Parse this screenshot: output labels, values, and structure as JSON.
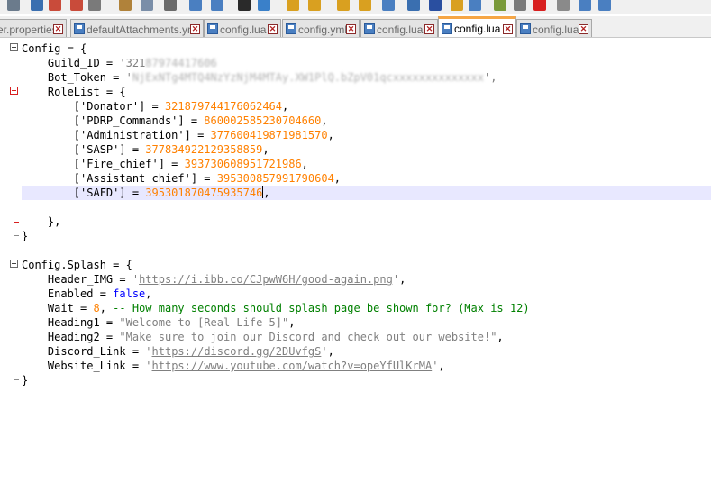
{
  "toolbar": {
    "icons": [
      "save-all-icon",
      "close-icon",
      "close-all-icon",
      "print-icon",
      "cut-icon",
      "copy-icon",
      "paste-icon",
      "undo-icon",
      "redo-icon",
      "find-icon",
      "replace-icon",
      "zoom-in-icon",
      "zoom-out-icon",
      "sync-v-icon",
      "sync-h-icon",
      "wrap-icon",
      "all-chars-icon",
      "indent-guide-icon",
      "doc-map-icon",
      "function-list-icon",
      "folder-workspace-icon",
      "monitor-icon",
      "record-macro-icon",
      "stop-macro-icon",
      "play-macro-icon",
      "run-macro-icon",
      "save-macro-icon"
    ]
  },
  "tabs": [
    {
      "label": "er.properties",
      "active": false
    },
    {
      "label": "defaultAttachments.yml",
      "active": false
    },
    {
      "label": "config.lua",
      "active": false
    },
    {
      "label": "config.yml",
      "active": false
    },
    {
      "label": "config.lua",
      "active": false
    },
    {
      "label": "config.lua",
      "active": true
    },
    {
      "label": "config.lua",
      "active": false
    }
  ],
  "tab_close_glyph": "✕",
  "editor": {
    "lines": [
      {
        "indent": "",
        "tokens": [
          {
            "t": "Config = {",
            "c": ""
          }
        ]
      },
      {
        "indent": "    ",
        "tokens": [
          {
            "t": "Guild_ID = ",
            "c": ""
          },
          {
            "t": "'321",
            "c": "str"
          },
          {
            "t": "87974417606",
            "c": "blur"
          }
        ]
      },
      {
        "indent": "    ",
        "tokens": [
          {
            "t": "Bot_Token = ",
            "c": ""
          },
          {
            "t": "'",
            "c": "str"
          },
          {
            "t": "NjExNTg4MTQ4NzYzNjM4MTAy.XW1PlQ.bZpV01qcxxxxxxxxxxxxxx",
            "c": "blur"
          },
          {
            "t": "',",
            "c": "str"
          }
        ]
      },
      {
        "indent": "    ",
        "tokens": [
          {
            "t": "RoleList = {",
            "c": ""
          }
        ]
      },
      {
        "indent": "        ",
        "tokens": [
          {
            "t": "['Donator'] = ",
            "c": ""
          },
          {
            "t": "321879744176062464",
            "c": "num"
          },
          {
            "t": ",",
            "c": ""
          }
        ]
      },
      {
        "indent": "        ",
        "tokens": [
          {
            "t": "['PDRP_Commands'] = ",
            "c": ""
          },
          {
            "t": "860002585230704660",
            "c": "num"
          },
          {
            "t": ",",
            "c": ""
          }
        ]
      },
      {
        "indent": "        ",
        "tokens": [
          {
            "t": "['Administration'] = ",
            "c": ""
          },
          {
            "t": "377600419871981570",
            "c": "num"
          },
          {
            "t": ",",
            "c": ""
          }
        ]
      },
      {
        "indent": "        ",
        "tokens": [
          {
            "t": "['SASP'] = ",
            "c": ""
          },
          {
            "t": "377834922129358859",
            "c": "num"
          },
          {
            "t": ",",
            "c": ""
          }
        ]
      },
      {
        "indent": "        ",
        "tokens": [
          {
            "t": "['Fire_chief'] = ",
            "c": ""
          },
          {
            "t": "393730608951721986",
            "c": "num"
          },
          {
            "t": ",",
            "c": ""
          }
        ]
      },
      {
        "indent": "        ",
        "tokens": [
          {
            "t": "['Assistant chief'] = ",
            "c": ""
          },
          {
            "t": "395300857991790604",
            "c": "num"
          },
          {
            "t": ",",
            "c": ""
          }
        ]
      },
      {
        "indent": "        ",
        "tokens": [
          {
            "t": "['SAFD'] = ",
            "c": ""
          },
          {
            "t": "395301870475935746",
            "c": "num"
          },
          {
            "t": ",",
            "c": ""
          }
        ],
        "current": true
      },
      {
        "indent": "",
        "tokens": []
      },
      {
        "indent": "    ",
        "tokens": [
          {
            "t": "},",
            "c": ""
          }
        ]
      },
      {
        "indent": "",
        "tokens": [
          {
            "t": "}",
            "c": ""
          }
        ]
      },
      {
        "indent": "",
        "tokens": []
      },
      {
        "indent": "",
        "tokens": [
          {
            "t": "Config.Splash = {",
            "c": ""
          }
        ]
      },
      {
        "indent": "    ",
        "tokens": [
          {
            "t": "Header_IMG = ",
            "c": ""
          },
          {
            "t": "'",
            "c": "str"
          },
          {
            "t": "https://i.ibb.co/CJpwW6H/good-again.png",
            "c": "url"
          },
          {
            "t": "'",
            "c": "str"
          },
          {
            "t": ",",
            "c": ""
          }
        ]
      },
      {
        "indent": "    ",
        "tokens": [
          {
            "t": "Enabled = ",
            "c": ""
          },
          {
            "t": "false",
            "c": "kw"
          },
          {
            "t": ",",
            "c": ""
          }
        ]
      },
      {
        "indent": "    ",
        "tokens": [
          {
            "t": "Wait = ",
            "c": ""
          },
          {
            "t": "8",
            "c": "num"
          },
          {
            "t": ", ",
            "c": ""
          },
          {
            "t": "-- How many seconds should splash page be shown for? (Max is 12)",
            "c": "cmt"
          }
        ]
      },
      {
        "indent": "    ",
        "tokens": [
          {
            "t": "Heading1 = ",
            "c": ""
          },
          {
            "t": "\"Welcome to [Real Life 5]\"",
            "c": "str"
          },
          {
            "t": ",",
            "c": ""
          }
        ]
      },
      {
        "indent": "    ",
        "tokens": [
          {
            "t": "Heading2 = ",
            "c": ""
          },
          {
            "t": "\"Make sure to join our Discord and check out our website!\"",
            "c": "str"
          },
          {
            "t": ",",
            "c": ""
          }
        ]
      },
      {
        "indent": "    ",
        "tokens": [
          {
            "t": "Discord_Link = ",
            "c": ""
          },
          {
            "t": "'",
            "c": "str"
          },
          {
            "t": "https://discord.gg/2DUvfgS",
            "c": "url"
          },
          {
            "t": "'",
            "c": "str"
          },
          {
            "t": ",",
            "c": ""
          }
        ]
      },
      {
        "indent": "    ",
        "tokens": [
          {
            "t": "Website_Link = ",
            "c": ""
          },
          {
            "t": "'",
            "c": "str"
          },
          {
            "t": "https://www.youtube.com/watch?v=opeYfUlKrMA",
            "c": "url"
          },
          {
            "t": "'",
            "c": "str"
          },
          {
            "t": ",",
            "c": ""
          }
        ]
      },
      {
        "indent": "",
        "tokens": [
          {
            "t": "}",
            "c": ""
          }
        ]
      }
    ]
  },
  "colors": {
    "active_tab_accent": "#f6a645",
    "current_line": "#e8e8ff",
    "string": "#808080",
    "number": "#ff8000",
    "keyword": "#0000ff",
    "comment": "#008000",
    "fold_active": "#d81f1f"
  }
}
